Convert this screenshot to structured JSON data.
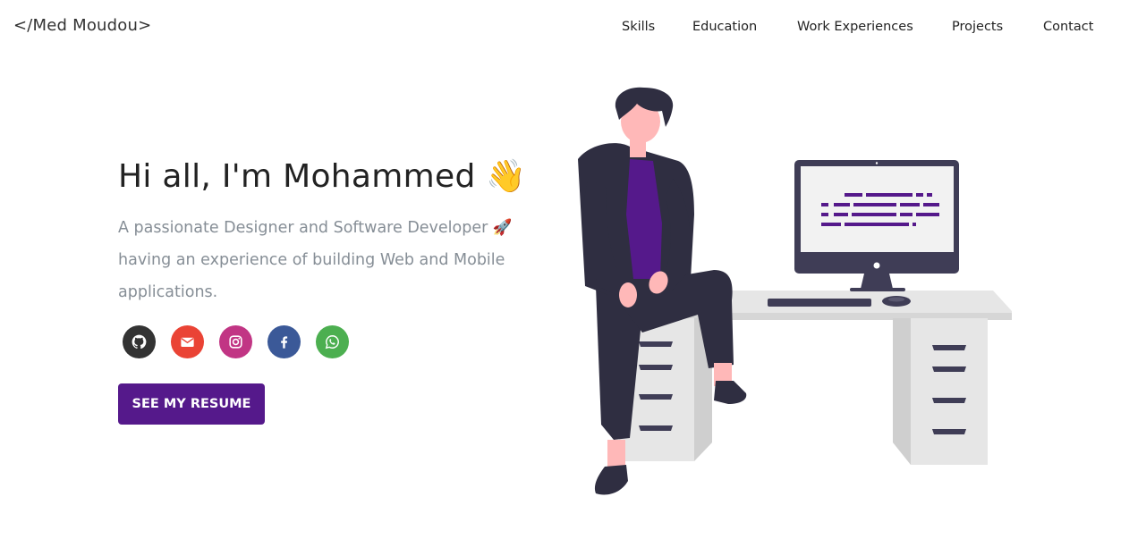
{
  "header": {
    "logo": "</Med Moudou>",
    "nav": [
      "Skills",
      "Education",
      "Work Experiences",
      "Projects",
      "Contact"
    ]
  },
  "hero": {
    "greeting": "Hi all, I'm Mohammed",
    "greeting_emoji": "👋",
    "subtitle": "A passionate Designer and Software Developer",
    "subtitle_emoji": "🚀",
    "subtitle_rest": "having an experience of building Web and Mobile applications.",
    "resume_label": "SEE MY RESUME"
  },
  "social": [
    {
      "name": "github-icon",
      "color": "#333333"
    },
    {
      "name": "email-icon",
      "color": "#ea4335"
    },
    {
      "name": "instagram-icon",
      "color": "#c13584"
    },
    {
      "name": "facebook-icon",
      "color": "#3b5998"
    },
    {
      "name": "whatsapp-icon",
      "color": "#4caf50"
    }
  ],
  "colors": {
    "accent": "#55198b",
    "text_primary": "#222222",
    "text_secondary": "#868e96"
  }
}
